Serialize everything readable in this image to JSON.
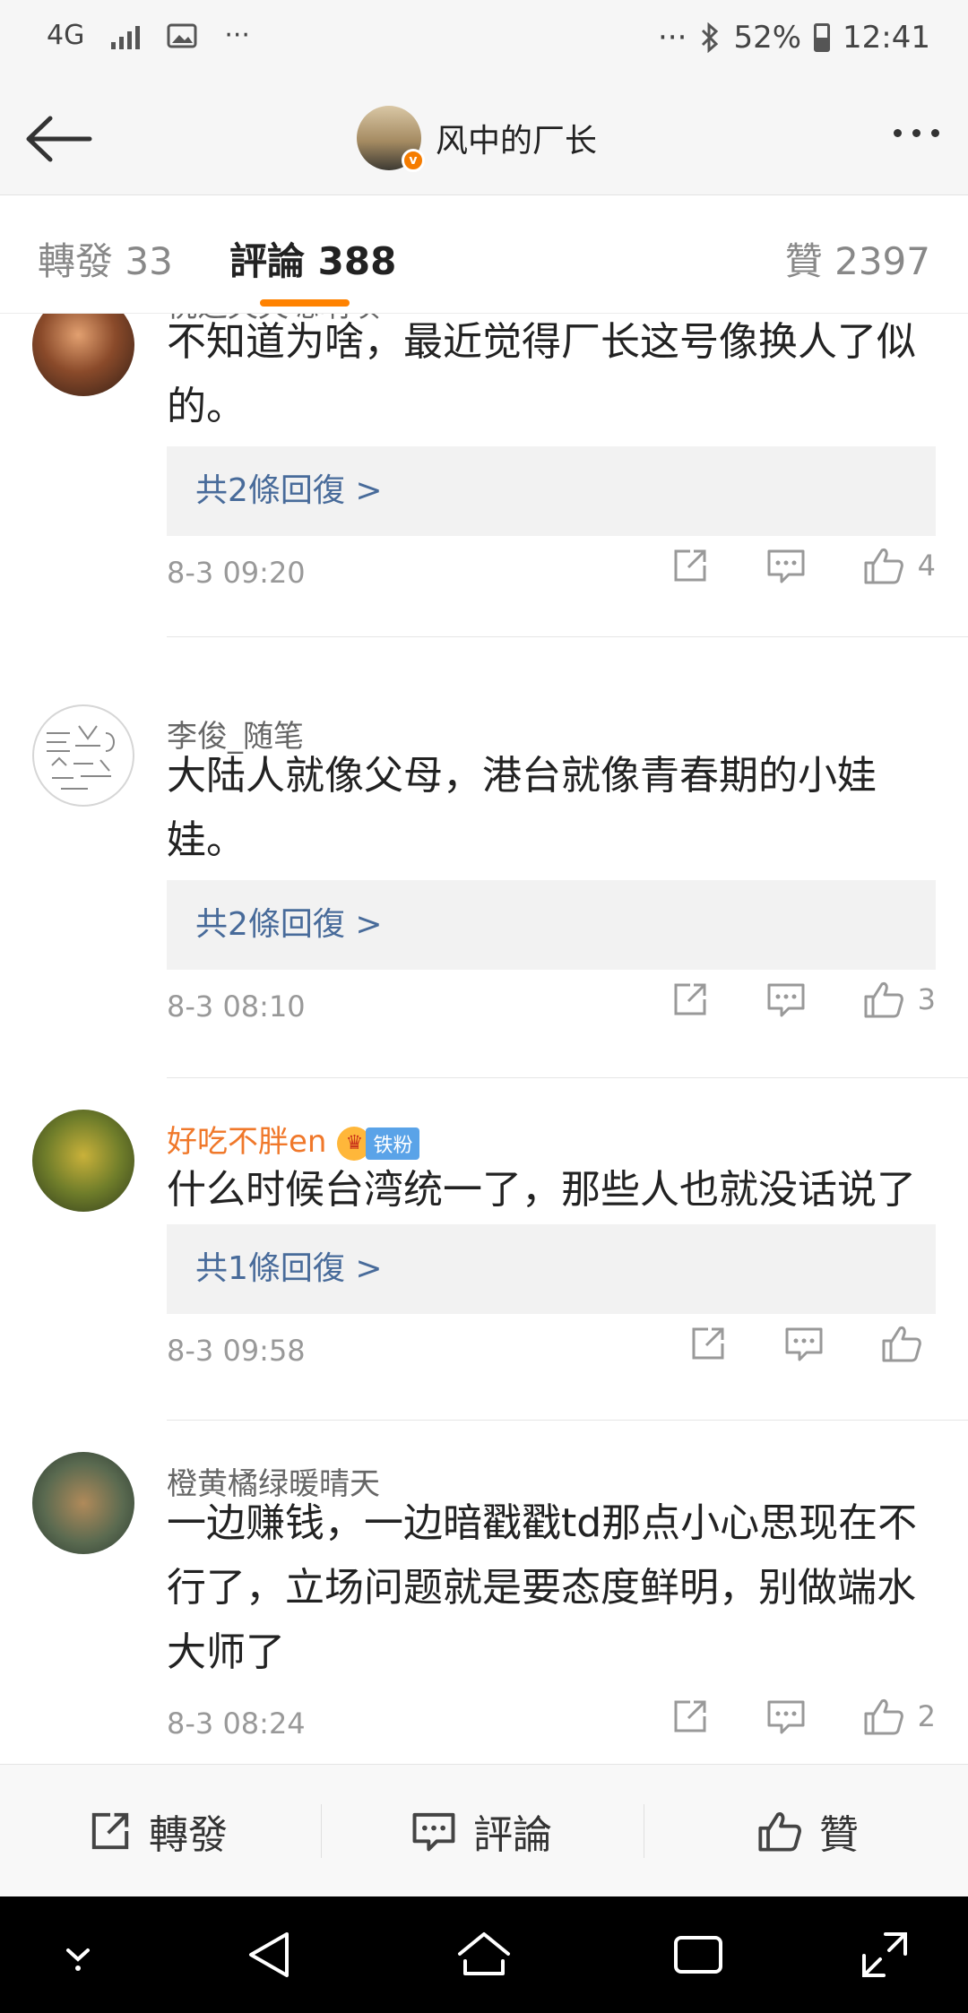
{
  "status_bar": {
    "network": "4G",
    "more": "···",
    "dots": "···",
    "battery": "52%",
    "time": "12:41"
  },
  "header": {
    "title": "风中的厂长"
  },
  "tabs": {
    "repost": "轉發 33",
    "comments": "評論 388",
    "likes": "贊 2397"
  },
  "comments": [
    {
      "name": "桃之夭夭嗯呐呗",
      "text": "不知道为啥，最近觉得厂长这号像换人了似的。",
      "replies": "共2條回復 >",
      "time": "8-3 09:20",
      "likes": "4"
    },
    {
      "name": "李俊_随笔",
      "text": "大陆人就像父母，港台就像青春期的小娃娃。",
      "replies": "共2條回復 >",
      "time": "8-3 08:10",
      "likes": "3"
    },
    {
      "name": "好吃不胖en",
      "badge": "铁粉",
      "text": "什么时候台湾统一了，那些人也就没话说了",
      "replies": "共1條回復 >",
      "time": "8-3 09:58",
      "likes": ""
    },
    {
      "name": "橙黄橘绿暖晴天",
      "text": "一边赚钱，一边暗戳戳td那点小心思现在不行了，立场问题就是要态度鲜明，别做端水大师了",
      "time": "8-3 08:24",
      "likes": "2"
    }
  ],
  "bottom_bar": {
    "repost": "轉發",
    "comment": "評論",
    "like": "贊"
  },
  "colors": {
    "accent": "#ff8200",
    "link": "#486b9a",
    "vip_name": "#f0782a"
  }
}
